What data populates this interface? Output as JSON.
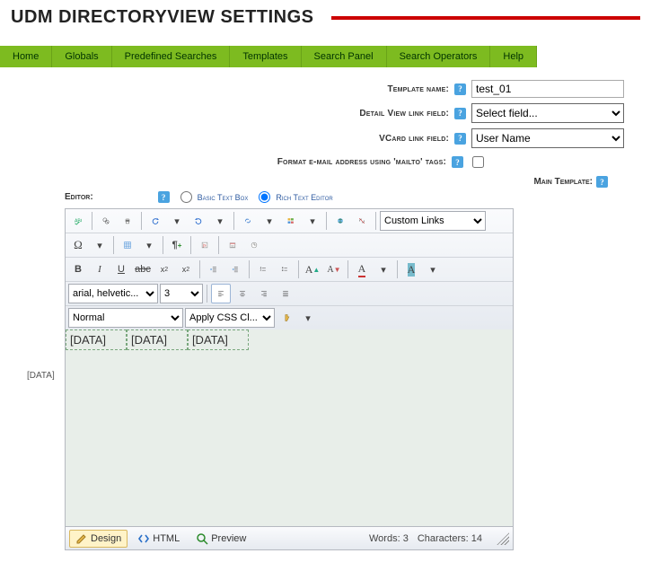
{
  "page_title": "UDM DIRECTORYVIEW SETTINGS",
  "nav": {
    "items": [
      "Home",
      "Globals",
      "Predefined Searches",
      "Templates",
      "Search Panel",
      "Search Operators",
      "Help"
    ]
  },
  "form": {
    "template_name_label": "Template name:",
    "template_name_value": "test_01",
    "detail_view_label": "Detail View link field:",
    "detail_view_value": "Select field...",
    "vcard_label": "VCard link field:",
    "vcard_value": "User Name",
    "mailto_label": "Format e-mail address using 'mailto' tags:",
    "mailto_checked": false,
    "main_template_label": "Main Template:"
  },
  "editor": {
    "label": "Editor:",
    "radio_basic": "Basic Text Box",
    "radio_rich": "Rich Text Editor",
    "radio_selected": "rich",
    "custom_links_label": "Custom Links",
    "font_family": "arial, helvetic...",
    "font_size": "3",
    "paragraph_format": "Normal",
    "css_class": "Apply CSS Cl...",
    "placeholders": [
      "[DATA]",
      "[DATA]",
      "[DATA]"
    ],
    "side_label": "[DATA]",
    "footer": {
      "design": "Design",
      "html": "HTML",
      "preview": "Preview",
      "words_label": "Words:",
      "words": "3",
      "chars_label": "Characters:",
      "chars": "14"
    }
  },
  "icons": {
    "help": "?"
  }
}
